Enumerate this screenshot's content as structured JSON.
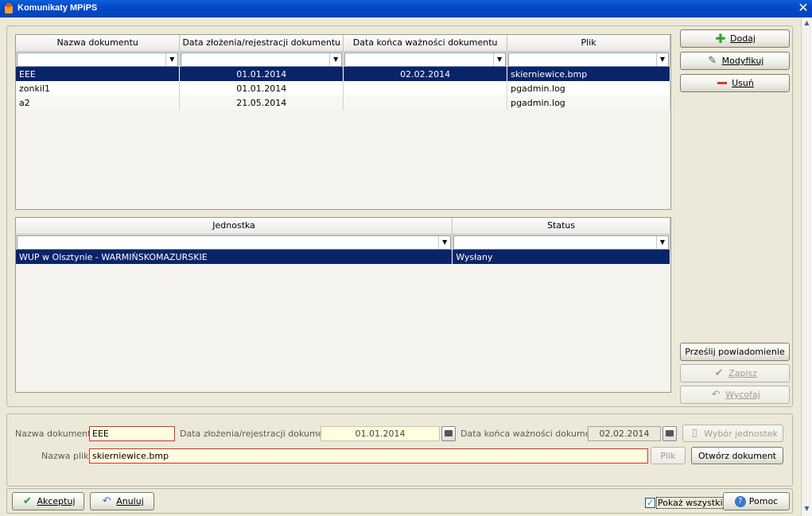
{
  "window": {
    "title": "Komunikaty MPiPS"
  },
  "documents_grid": {
    "columns": [
      "Nazwa dokumentu",
      "Data złożenia/rejestracji dokumentu",
      "Data końca ważności dokumentu",
      "Plik"
    ],
    "rows": [
      [
        "EEE",
        "01.01.2014",
        "02.02.2014",
        "skierniewice.bmp"
      ],
      [
        "zonkil1",
        "01.01.2014",
        "",
        "pgadmin.log"
      ],
      [
        "a2",
        "21.05.2014",
        "",
        "pgadmin.log"
      ]
    ],
    "selected_row": 0
  },
  "units_grid": {
    "columns": [
      "Jednostka",
      "Status"
    ],
    "rows": [
      [
        "WUP w Olsztynie - WARMIŃSKOMAZURSKIE",
        "Wysłany"
      ]
    ],
    "selected_row": 0
  },
  "side_buttons": {
    "add": "Dodaj",
    "modify": "Modyfikuj",
    "delete": "Usuń",
    "send_notification": "Prześlij powiadomienie",
    "save": "Zapisz",
    "revert": "Wycofaj"
  },
  "form": {
    "doc_name_label": "Nazwa dokumentu",
    "doc_name_value": "EEE",
    "reg_date_label": "Data złożenia/rejestracji dokumentu",
    "reg_date_value": "01.01.2014",
    "expiry_label": "Data końca ważności dokumentu",
    "expiry_value": "02.02.2014",
    "select_units_button": "Wybór jednostek",
    "file_name_label": "Nazwa pliku",
    "file_name_value": "skierniewice.bmp",
    "file_button": "Plik",
    "open_document_button": "Otwórz dokument"
  },
  "footer": {
    "accept": "Akceptuj",
    "cancel": "Anuluj",
    "show_all": "Pokaż wszystkie",
    "show_all_checked": true,
    "help": "Pomoc"
  },
  "colors": {
    "selection": "#0a246a",
    "title_bar": "#0449c9",
    "required_border": "#cc3333"
  }
}
